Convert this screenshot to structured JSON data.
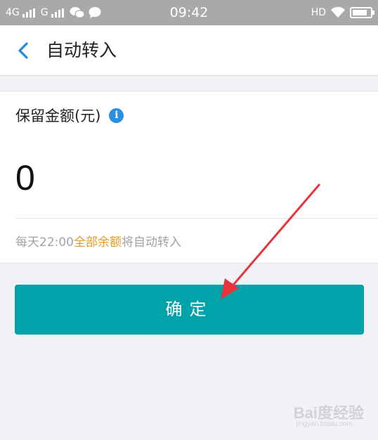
{
  "status_bar": {
    "network_1": "4G",
    "network_2": "G",
    "time": "09:42",
    "hd": "HD",
    "icons": [
      "signal-icon",
      "wechat-icon",
      "message-icon",
      "wifi-icon",
      "battery-icon"
    ],
    "battery_level": 0.85
  },
  "nav": {
    "title": "自动转入",
    "back_icon": "chevron-left-icon"
  },
  "form": {
    "label": "保留金额(元)",
    "info_icon_glyph": "i",
    "amount_value": "0",
    "hint_prefix": "每天22:00",
    "hint_highlight": "全部余额",
    "hint_suffix": "将自动转入"
  },
  "confirm_button": {
    "label": "确定"
  },
  "watermark": {
    "text": "Bai度经验",
    "sub": "jingyan.baidu.com"
  },
  "colors": {
    "accent": "#00a3a9",
    "highlight": "#e79a22",
    "info": "#2b8fe0",
    "annotation_arrow": "#e8333b"
  }
}
